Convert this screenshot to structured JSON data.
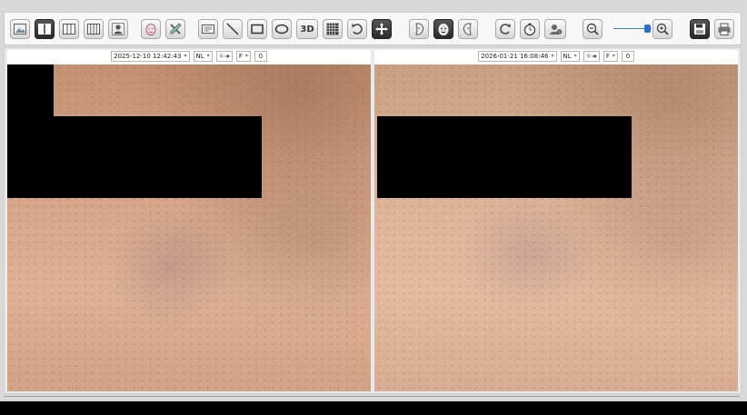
{
  "toolbar": {
    "buttons": [
      {
        "name": "single-view-icon",
        "active": false
      },
      {
        "name": "split-2-view-icon",
        "active": true
      },
      {
        "name": "split-3-view-icon",
        "active": false
      },
      {
        "name": "split-4-view-icon",
        "active": false
      },
      {
        "name": "patient-icon",
        "active": false
      },
      {
        "name": "face-analysis-icon",
        "active": false
      },
      {
        "name": "tools-icon",
        "active": false
      },
      {
        "name": "text-box-icon",
        "active": false
      },
      {
        "name": "line-tool-icon",
        "active": false
      },
      {
        "name": "rectangle-tool-icon",
        "active": false
      },
      {
        "name": "ellipse-tool-icon",
        "active": false
      },
      {
        "name": "3d-view-icon",
        "active": false
      },
      {
        "name": "grid-icon",
        "active": false
      },
      {
        "name": "undo-icon",
        "active": false
      },
      {
        "name": "move-icon",
        "active": true
      },
      {
        "name": "face-left-icon",
        "active": false
      },
      {
        "name": "face-front-icon",
        "active": true
      },
      {
        "name": "face-right-icon",
        "active": false
      },
      {
        "name": "redo-icon",
        "active": false
      },
      {
        "name": "timer-icon",
        "active": false
      },
      {
        "name": "camera-icon",
        "active": false
      },
      {
        "name": "zoom-out-icon",
        "active": false
      },
      {
        "name": "zoom-in-icon",
        "active": false
      },
      {
        "name": "save-icon",
        "active": true
      },
      {
        "name": "print-icon",
        "active": false
      }
    ],
    "three_d_label": "3D",
    "zoom_level": 0.85
  },
  "panels": [
    {
      "date": "2025-12-10 12:42:43",
      "mode": "NL",
      "light": "☼➜",
      "view": "F",
      "extra": "0"
    },
    {
      "date": "2026-01-21 16:08:46",
      "mode": "NL",
      "light": "☼➜",
      "view": "F",
      "extra": "0"
    }
  ],
  "colors": {
    "accent": "#2a6fd0",
    "toolbar_bg": "#f7f7f7",
    "status_bar": "#000000"
  }
}
